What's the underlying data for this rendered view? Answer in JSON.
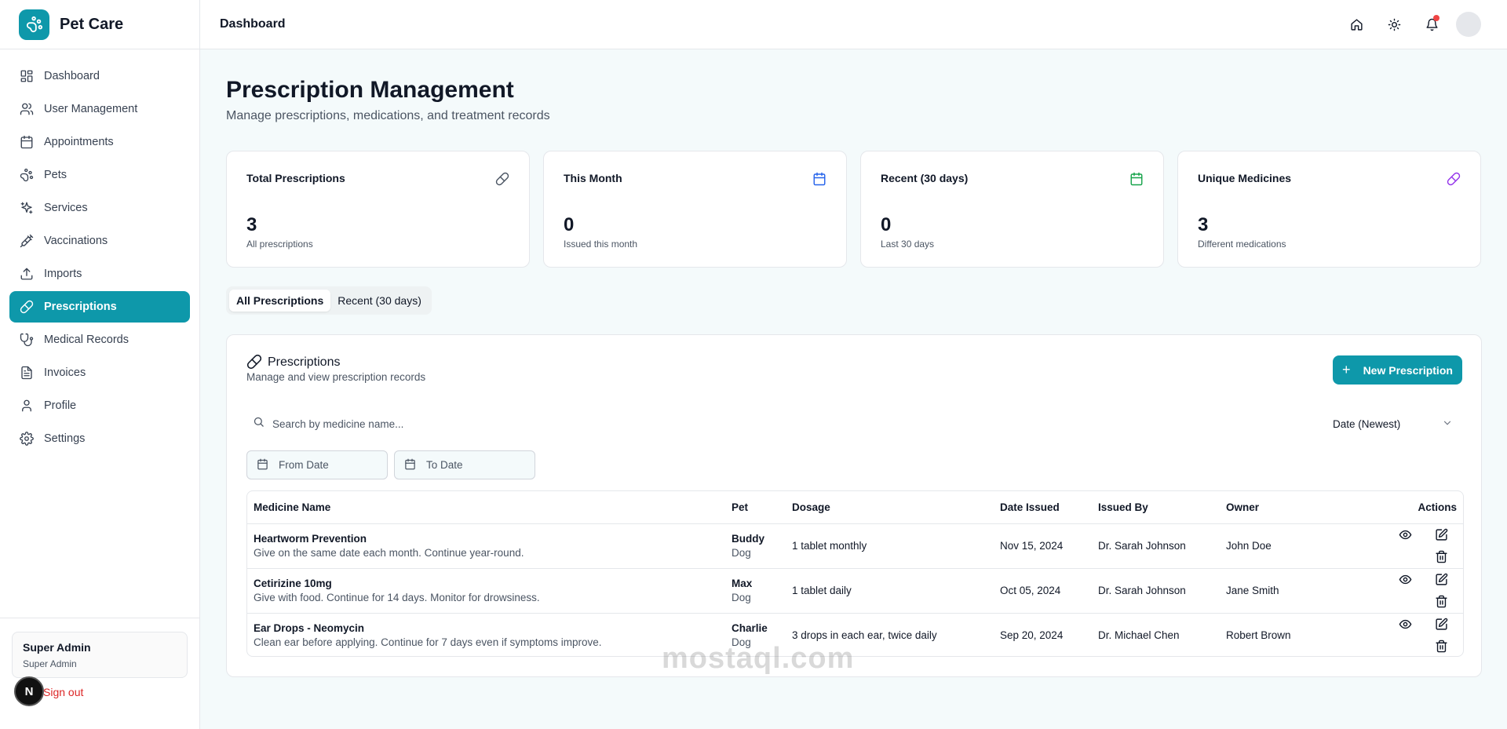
{
  "brand": {
    "name": "Pet Care"
  },
  "header": {
    "title": "Dashboard"
  },
  "sidebar": {
    "items": [
      {
        "label": "Dashboard",
        "icon": "grid-icon"
      },
      {
        "label": "User Management",
        "icon": "users-icon"
      },
      {
        "label": "Appointments",
        "icon": "calendar-icon"
      },
      {
        "label": "Pets",
        "icon": "paw-icon"
      },
      {
        "label": "Services",
        "icon": "sparkles-icon"
      },
      {
        "label": "Vaccinations",
        "icon": "syringe-icon"
      },
      {
        "label": "Imports",
        "icon": "upload-icon"
      },
      {
        "label": "Prescriptions",
        "icon": "pill-icon",
        "active": true
      },
      {
        "label": "Medical Records",
        "icon": "stethoscope-icon"
      },
      {
        "label": "Invoices",
        "icon": "file-text-icon"
      },
      {
        "label": "Profile",
        "icon": "user-icon"
      },
      {
        "label": "Settings",
        "icon": "gear-icon"
      }
    ],
    "user": {
      "name": "Super Admin",
      "role": "Super Admin"
    },
    "signout": "Sign out",
    "badge": "N"
  },
  "page": {
    "title": "Prescription Management",
    "subtitle": "Manage prescriptions, medications, and treatment records"
  },
  "stats": [
    {
      "title": "Total Prescriptions",
      "value": "3",
      "desc": "All prescriptions",
      "icon": "pill-icon",
      "color": "#4b5563"
    },
    {
      "title": "This Month",
      "value": "0",
      "desc": "Issued this month",
      "icon": "calendar-icon",
      "color": "#2563eb"
    },
    {
      "title": "Recent (30 days)",
      "value": "0",
      "desc": "Last 30 days",
      "icon": "calendar-icon",
      "color": "#16a34a"
    },
    {
      "title": "Unique Medicines",
      "value": "3",
      "desc": "Different medications",
      "icon": "pill-icon",
      "color": "#9333ea"
    }
  ],
  "tabs": [
    {
      "label": "All Prescriptions",
      "active": true
    },
    {
      "label": "Recent (30 days)",
      "active": false
    }
  ],
  "panel": {
    "title": "Prescriptions",
    "subtitle": "Manage and view prescription records",
    "new_button": "New Prescription",
    "search_placeholder": "Search by medicine name...",
    "sort_value": "Date (Newest)",
    "from_date": "From Date",
    "to_date": "To Date"
  },
  "table": {
    "headers": [
      "Medicine Name",
      "Pet",
      "Dosage",
      "Date Issued",
      "Issued By",
      "Owner",
      "Actions"
    ],
    "rows": [
      {
        "medicine": "Heartworm Prevention",
        "note": "Give on the same date each month. Continue year-round.",
        "pet": "Buddy",
        "species": "Dog",
        "dosage": "1 tablet monthly",
        "date": "Nov 15, 2024",
        "issued_by": "Dr. Sarah Johnson",
        "owner": "John Doe"
      },
      {
        "medicine": "Cetirizine 10mg",
        "note": "Give with food. Continue for 14 days. Monitor for drowsiness.",
        "pet": "Max",
        "species": "Dog",
        "dosage": "1 tablet daily",
        "date": "Oct 05, 2024",
        "issued_by": "Dr. Sarah Johnson",
        "owner": "Jane Smith"
      },
      {
        "medicine": "Ear Drops - Neomycin",
        "note": "Clean ear before applying. Continue for 7 days even if symptoms improve.",
        "pet": "Charlie",
        "species": "Dog",
        "dosage": "3 drops in each ear, twice daily",
        "date": "Sep 20, 2024",
        "issued_by": "Dr. Michael Chen",
        "owner": "Robert Brown"
      }
    ]
  },
  "watermark": "mostaql.com",
  "colors": {
    "accent": "#0e98aa",
    "danger": "#dc2626",
    "notification": "#ef4444"
  }
}
